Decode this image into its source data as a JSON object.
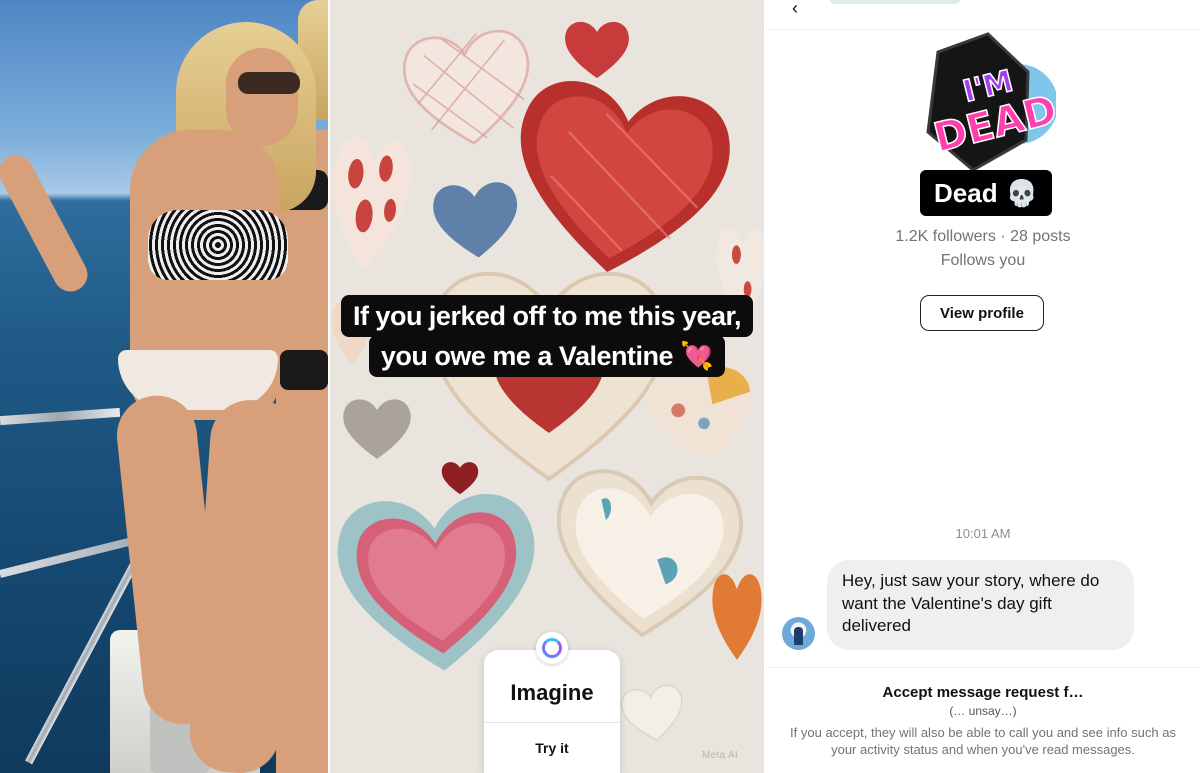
{
  "story": {
    "caption_line1": "If you jerked off to me this year,",
    "caption_line2": "you owe me a Valentine 💘",
    "imagine_card": {
      "title": "Imagine",
      "action": "Try it"
    },
    "watermark": "Meta AI"
  },
  "chat": {
    "profile": {
      "sticker_text": "I'M DEAD",
      "name": "Dead",
      "name_emoji": "💀",
      "stats": "1.2K followers · 28 posts",
      "follows_status": "Follows you",
      "view_profile_label": "View profile"
    },
    "timestamp": "10:01 AM",
    "messages": [
      {
        "sender": "other",
        "text": "Hey, just saw your story, where do want the Valentine's day gift delivered"
      }
    ],
    "request": {
      "title": "Accept message request f…",
      "subtitle": "(… unsay…)",
      "info": "If you accept, they will also be able to call you and see info such as your activity status and when you've read messages."
    }
  },
  "colors": {
    "chat_bubble_bg": "#efefef",
    "caption_bg": "#0c0c0c",
    "muted_text": "#737373",
    "sticker_purple": "#a43cf0",
    "sticker_pink": "#ff3fae"
  }
}
